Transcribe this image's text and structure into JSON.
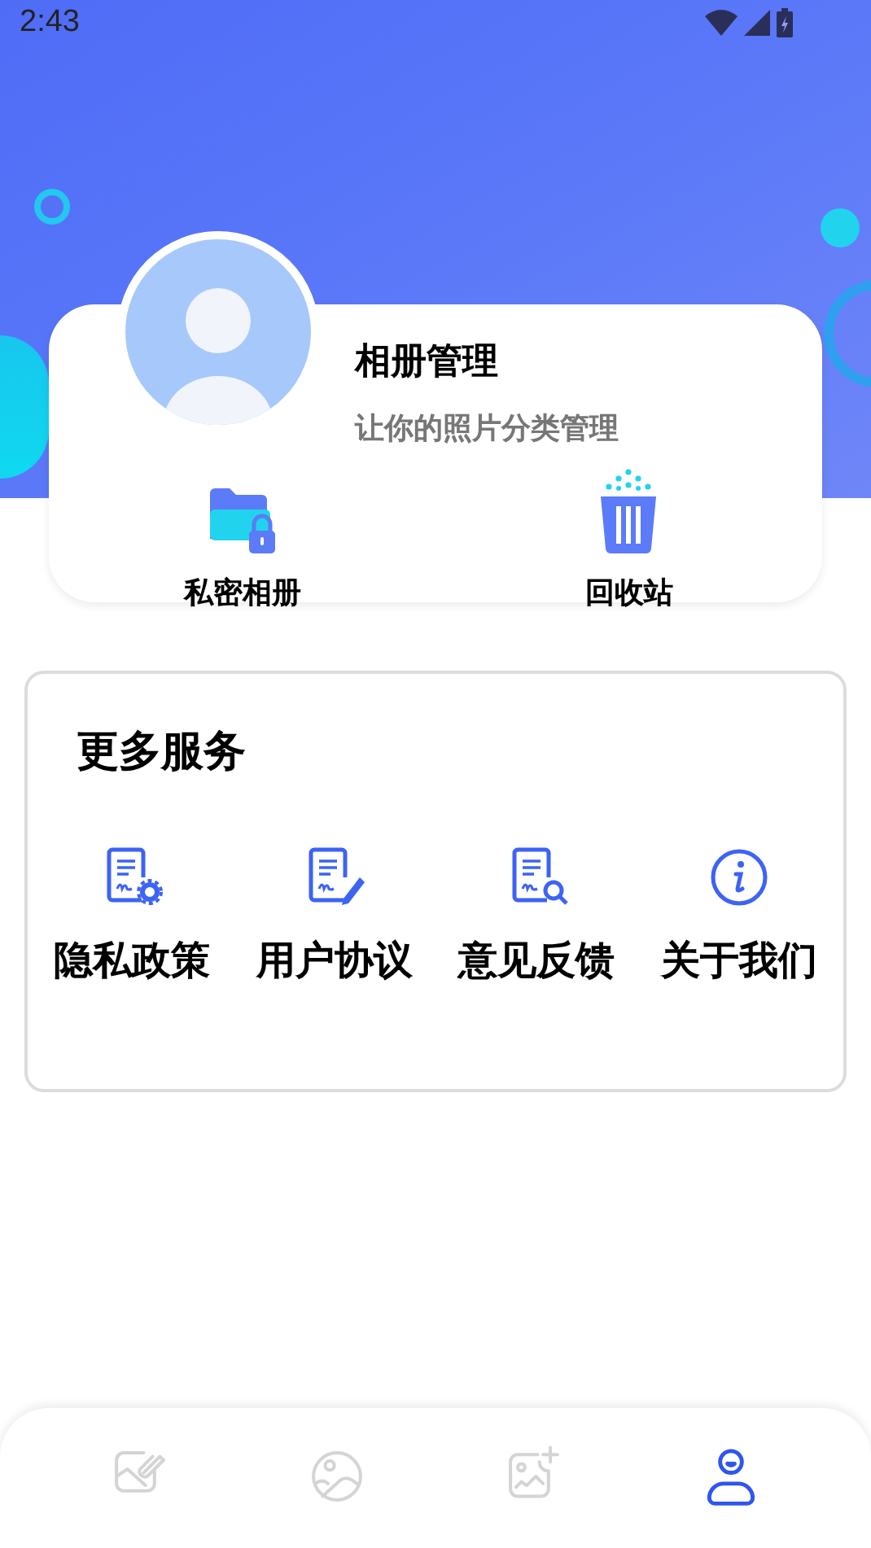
{
  "status_bar": {
    "time": "2:43"
  },
  "album_card": {
    "title": "相册管理",
    "subtitle": "让你的照片分类管理",
    "actions": [
      {
        "label": "私密相册",
        "kind": "private"
      },
      {
        "label": "回收站",
        "kind": "trash"
      }
    ]
  },
  "services": {
    "title": "更多服务",
    "items": [
      {
        "label": "隐私政策",
        "kind": "settings"
      },
      {
        "label": "用户协议",
        "kind": "edit"
      },
      {
        "label": "意见反馈",
        "kind": "search"
      },
      {
        "label": "关于我们",
        "kind": "info"
      }
    ]
  },
  "bottom_nav": [
    {
      "kind": "edit-photo",
      "selected": false
    },
    {
      "kind": "gallery",
      "selected": false
    },
    {
      "kind": "add-photo",
      "selected": false
    },
    {
      "kind": "profile",
      "selected": true
    }
  ]
}
